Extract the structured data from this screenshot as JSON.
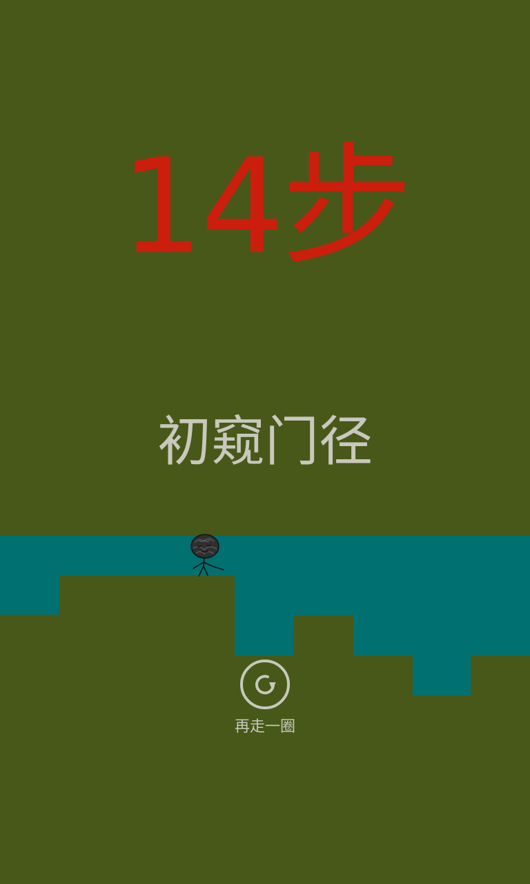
{
  "result": {
    "score_text": "14步",
    "rank_title": "初窥门径"
  },
  "restart": {
    "icon": "restart-icon",
    "label": "再走一圈"
  },
  "colors": {
    "background": "#475819",
    "water": "#007070",
    "score": "#cc1e0c",
    "text": "#c8c8bc"
  }
}
